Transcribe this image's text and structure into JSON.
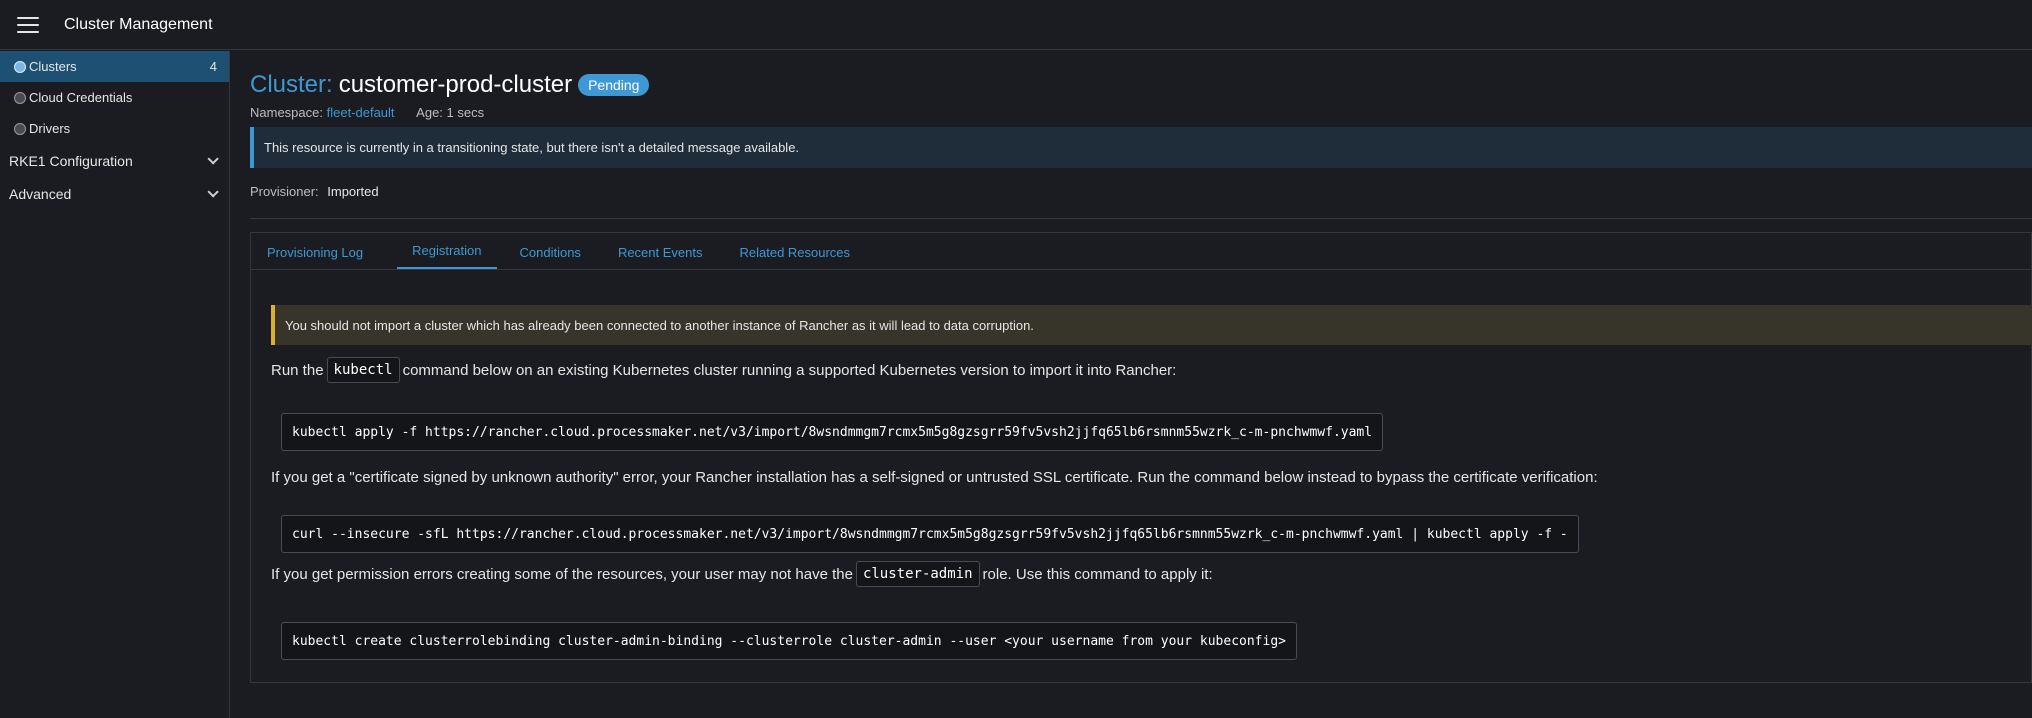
{
  "header": {
    "title": "Cluster Management"
  },
  "sidebar": {
    "items": [
      {
        "label": "Clusters",
        "count": "4",
        "active": true
      },
      {
        "label": "Cloud Credentials"
      },
      {
        "label": "Drivers"
      }
    ],
    "groups": [
      {
        "label": "RKE1 Configuration"
      },
      {
        "label": "Advanced"
      }
    ]
  },
  "page": {
    "title_prefix": "Cluster:",
    "title_name": "customer-prod-cluster",
    "state_badge": "Pending",
    "namespace_label": "Namespace:",
    "namespace_value": "fleet-default",
    "age_label": "Age:",
    "age_value": "1 secs",
    "info_banner": "This resource is currently in a transitioning state, but there isn't a detailed message available.",
    "provisioner_label": "Provisioner:",
    "provisioner_value": "Imported"
  },
  "tabs": [
    {
      "label": "Provisioning Log"
    },
    {
      "label": "Registration",
      "active": true
    },
    {
      "label": "Conditions"
    },
    {
      "label": "Recent Events"
    },
    {
      "label": "Related Resources"
    }
  ],
  "registration": {
    "warning": "You should not import a cluster which has already been connected to another instance of Rancher as it will lead to data corruption.",
    "p1_before": "Run the",
    "p1_code": "kubectl",
    "p1_after": "command below on an existing Kubernetes cluster running a supported Kubernetes version to import it into Rancher:",
    "cmd1": "kubectl apply -f https://rancher.cloud.processmaker.net/v3/import/8wsndmmgm7rcmx5m5g8gzsgrr59fv5vsh2jjfq65lb6rsmnm55wzrk_c-m-pnchwmwf.yaml",
    "p2": "If you get a \"certificate signed by unknown authority\" error, your Rancher installation has a self-signed or untrusted SSL certificate. Run the command below instead to bypass the certificate verification:",
    "cmd2": "curl --insecure -sfL https://rancher.cloud.processmaker.net/v3/import/8wsndmmgm7rcmx5m5g8gzsgrr59fv5vsh2jjfq65lb6rsmnm55wzrk_c-m-pnchwmwf.yaml | kubectl apply -f -",
    "p3_before": "If you get permission errors creating some of the resources, your user may not have the",
    "p3_code": "cluster-admin",
    "p3_after": "role. Use this command to apply it:",
    "cmd3": "kubectl create clusterrolebinding cluster-admin-binding --clusterrole cluster-admin --user <your username from your kubeconfig>"
  },
  "colors": {
    "accent": "#3d98d3",
    "active_nav": "#1e5073",
    "warning": "#dcb130",
    "background": "#1b1c21"
  }
}
